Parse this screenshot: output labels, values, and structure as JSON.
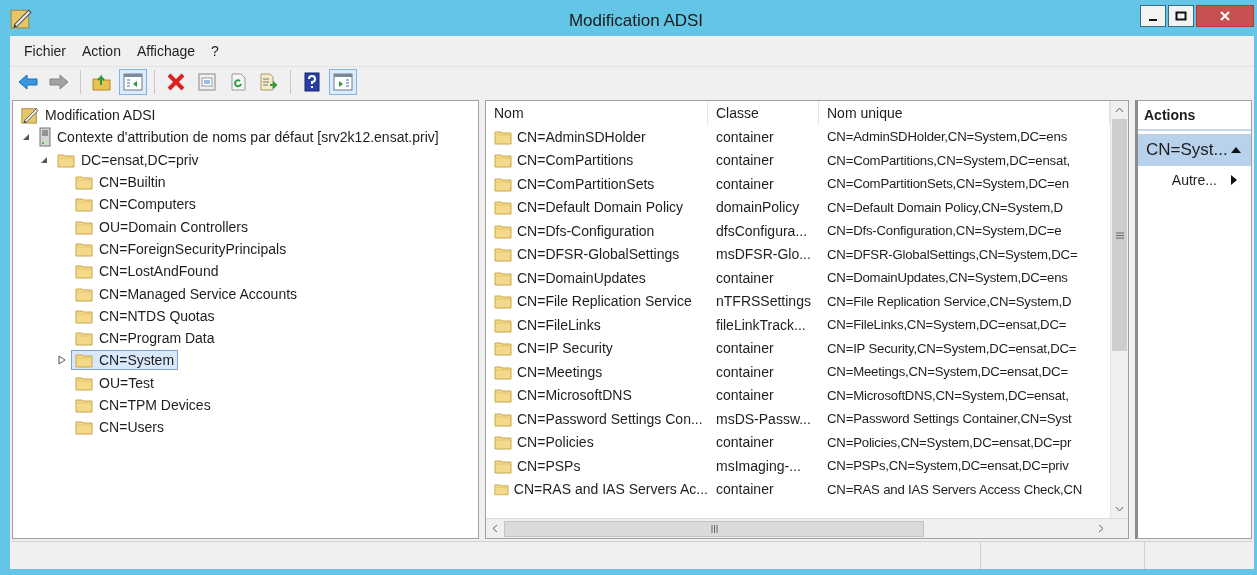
{
  "window": {
    "title": "Modification ADSI"
  },
  "menu": [
    "Fichier",
    "Action",
    "Affichage",
    "?"
  ],
  "toolbar": [
    {
      "kind": "back",
      "disabled": false,
      "pressed": false
    },
    {
      "kind": "forward",
      "disabled": true,
      "pressed": false
    },
    {
      "kind": "separator"
    },
    {
      "kind": "up",
      "disabled": false,
      "pressed": false
    },
    {
      "kind": "tree",
      "disabled": false,
      "pressed": true
    },
    {
      "kind": "separator"
    },
    {
      "kind": "delete",
      "disabled": false,
      "pressed": false
    },
    {
      "kind": "properties",
      "disabled": false,
      "pressed": false
    },
    {
      "kind": "refresh",
      "disabled": false,
      "pressed": false
    },
    {
      "kind": "export",
      "disabled": false,
      "pressed": false
    },
    {
      "kind": "separator"
    },
    {
      "kind": "help",
      "disabled": false,
      "pressed": false
    },
    {
      "kind": "actionpane",
      "disabled": false,
      "pressed": true
    }
  ],
  "tree": [
    {
      "label": "Modification ADSI",
      "kind": "root",
      "selected": false,
      "children": [
        {
          "label": "Contexte d'attribution de noms par défaut [srv2k12.ensat.priv]",
          "kind": "server",
          "selected": false,
          "expanded": true,
          "children": [
            {
              "label": "DC=ensat,DC=priv",
              "kind": "folder",
              "selected": false,
              "expanded": true,
              "children": [
                {
                  "label": "CN=Builtin",
                  "kind": "folder",
                  "selected": false
                },
                {
                  "label": "CN=Computers",
                  "kind": "folder",
                  "selected": false
                },
                {
                  "label": "OU=Domain Controllers",
                  "kind": "folder",
                  "selected": false
                },
                {
                  "label": "CN=ForeignSecurityPrincipals",
                  "kind": "folder",
                  "selected": false
                },
                {
                  "label": "CN=LostAndFound",
                  "kind": "folder",
                  "selected": false
                },
                {
                  "label": "CN=Managed Service Accounts",
                  "kind": "folder",
                  "selected": false
                },
                {
                  "label": "CN=NTDS Quotas",
                  "kind": "folder",
                  "selected": false
                },
                {
                  "label": "CN=Program Data",
                  "kind": "folder",
                  "selected": false
                },
                {
                  "label": "CN=System",
                  "kind": "folder",
                  "selected": true,
                  "expanded": false
                },
                {
                  "label": "OU=Test",
                  "kind": "folder",
                  "selected": false
                },
                {
                  "label": "CN=TPM Devices",
                  "kind": "folder",
                  "selected": false
                },
                {
                  "label": "CN=Users",
                  "kind": "folder",
                  "selected": false
                }
              ]
            }
          ]
        }
      ]
    }
  ],
  "table": {
    "columns": [
      "Nom",
      "Classe",
      "Nom unique"
    ],
    "rows": [
      {
        "name": "CN=AdminSDHolder",
        "class": "container",
        "dn": "CN=AdminSDHolder,CN=System,DC=ens"
      },
      {
        "name": "CN=ComPartitions",
        "class": "container",
        "dn": "CN=ComPartitions,CN=System,DC=ensat,"
      },
      {
        "name": "CN=ComPartitionSets",
        "class": "container",
        "dn": "CN=ComPartitionSets,CN=System,DC=en"
      },
      {
        "name": "CN=Default Domain Policy",
        "class": "domainPolicy",
        "dn": "CN=Default Domain Policy,CN=System,D"
      },
      {
        "name": "CN=Dfs-Configuration",
        "class": "dfsConfigura...",
        "dn": "CN=Dfs-Configuration,CN=System,DC=e"
      },
      {
        "name": "CN=DFSR-GlobalSettings",
        "class": "msDFSR-Glo...",
        "dn": "CN=DFSR-GlobalSettings,CN=System,DC="
      },
      {
        "name": "CN=DomainUpdates",
        "class": "container",
        "dn": "CN=DomainUpdates,CN=System,DC=ens"
      },
      {
        "name": "CN=File Replication Service",
        "class": "nTFRSSettings",
        "dn": "CN=File Replication Service,CN=System,D"
      },
      {
        "name": "CN=FileLinks",
        "class": "fileLinkTrack...",
        "dn": "CN=FileLinks,CN=System,DC=ensat,DC="
      },
      {
        "name": "CN=IP Security",
        "class": "container",
        "dn": "CN=IP Security,CN=System,DC=ensat,DC="
      },
      {
        "name": "CN=Meetings",
        "class": "container",
        "dn": "CN=Meetings,CN=System,DC=ensat,DC="
      },
      {
        "name": "CN=MicrosoftDNS",
        "class": "container",
        "dn": "CN=MicrosoftDNS,CN=System,DC=ensat,"
      },
      {
        "name": "CN=Password Settings Con...",
        "class": "msDS-Passw...",
        "dn": "CN=Password Settings Container,CN=Syst"
      },
      {
        "name": "CN=Policies",
        "class": "container",
        "dn": "CN=Policies,CN=System,DC=ensat,DC=pr"
      },
      {
        "name": "CN=PSPs",
        "class": "msImaging-...",
        "dn": "CN=PSPs,CN=System,DC=ensat,DC=priv"
      },
      {
        "name": "CN=RAS and IAS Servers Ac...",
        "class": "container",
        "dn": "CN=RAS and IAS Servers Access Check,CN"
      }
    ]
  },
  "actions": {
    "title": "Actions",
    "sections": [
      {
        "label": "CN=Syst...",
        "expanded": true,
        "items": [
          "Autre..."
        ]
      }
    ]
  }
}
